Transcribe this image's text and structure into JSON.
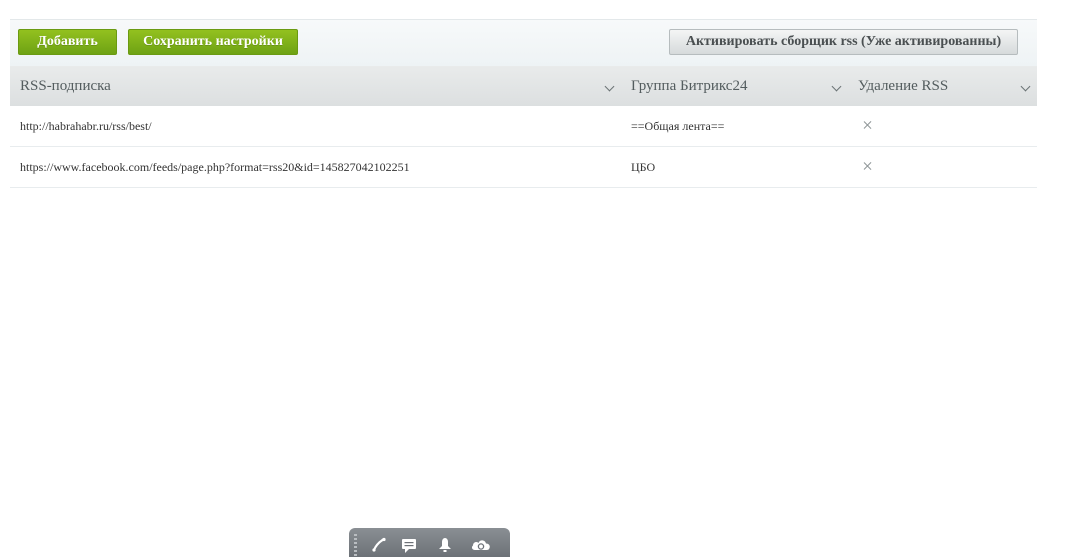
{
  "toolbar": {
    "add_label": "Добавить",
    "save_label": "Сохранить настройки",
    "activate_label": "Активировать сборщик rss (Уже активированны)"
  },
  "table": {
    "columns": [
      "RSS-подписка",
      "Группа Битрикс24",
      "Удаление RSS"
    ],
    "rows": [
      {
        "url": "http://habrahabr.ru/rss/best/",
        "group": "==Общая лента=="
      },
      {
        "url": "https://www.facebook.com/feeds/page.php?format=rss20&id=145827042102251",
        "group": "ЦБО"
      }
    ]
  },
  "icons": {
    "column_sort": "chevron-down-icon",
    "delete": "close-icon",
    "messenger": [
      "phone-icon",
      "chat-icon",
      "bell-icon",
      "cloud-icon"
    ]
  },
  "colors": {
    "accent_green": "#7fb21a",
    "header_bg": "#dfe2e3",
    "messenger_bar": "#7a7f85"
  }
}
